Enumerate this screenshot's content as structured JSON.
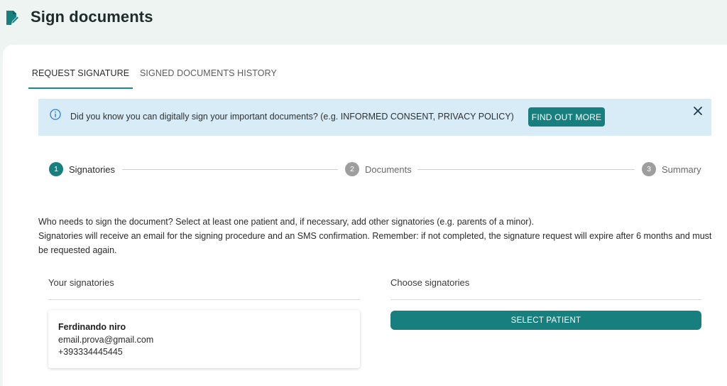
{
  "header": {
    "title": "Sign documents",
    "icon": "document-sign-icon",
    "accent": "#17807e"
  },
  "tabs": [
    {
      "label": "REQUEST SIGNATURE",
      "active": true
    },
    {
      "label": "SIGNED DOCUMENTS HISTORY",
      "active": false
    }
  ],
  "banner": {
    "text": "Did you know you can digitally sign your important documents? (e.g. INFORMED CONSENT, PRIVACY POLICY)",
    "button_label": "FIND OUT MORE",
    "background": "#d7ecf6"
  },
  "stepper": {
    "steps": [
      {
        "number": "1",
        "label": "Signatories",
        "active": true
      },
      {
        "number": "2",
        "label": "Documents",
        "active": false
      },
      {
        "number": "3",
        "label": "Summary",
        "active": false
      }
    ],
    "active_color": "#17807e",
    "inactive_color": "#9e9e9e"
  },
  "description": {
    "line1": "Who needs to sign the document? Select at least one patient and, if necessary, add other signatories (e.g. parents of a minor).",
    "line2": "Signatories will receive an email for the signing procedure and an SMS confirmation. Remember: if not completed, the signature request will expire after 6 months and must be requested again."
  },
  "your_signatories": {
    "title": "Your signatories",
    "items": [
      {
        "name": "Ferdinando niro",
        "email": "email.prova@gmail.com",
        "phone": "+393334445445"
      }
    ]
  },
  "choose_signatories": {
    "title": "Choose signatories",
    "button_label": "SELECT PATIENT"
  }
}
